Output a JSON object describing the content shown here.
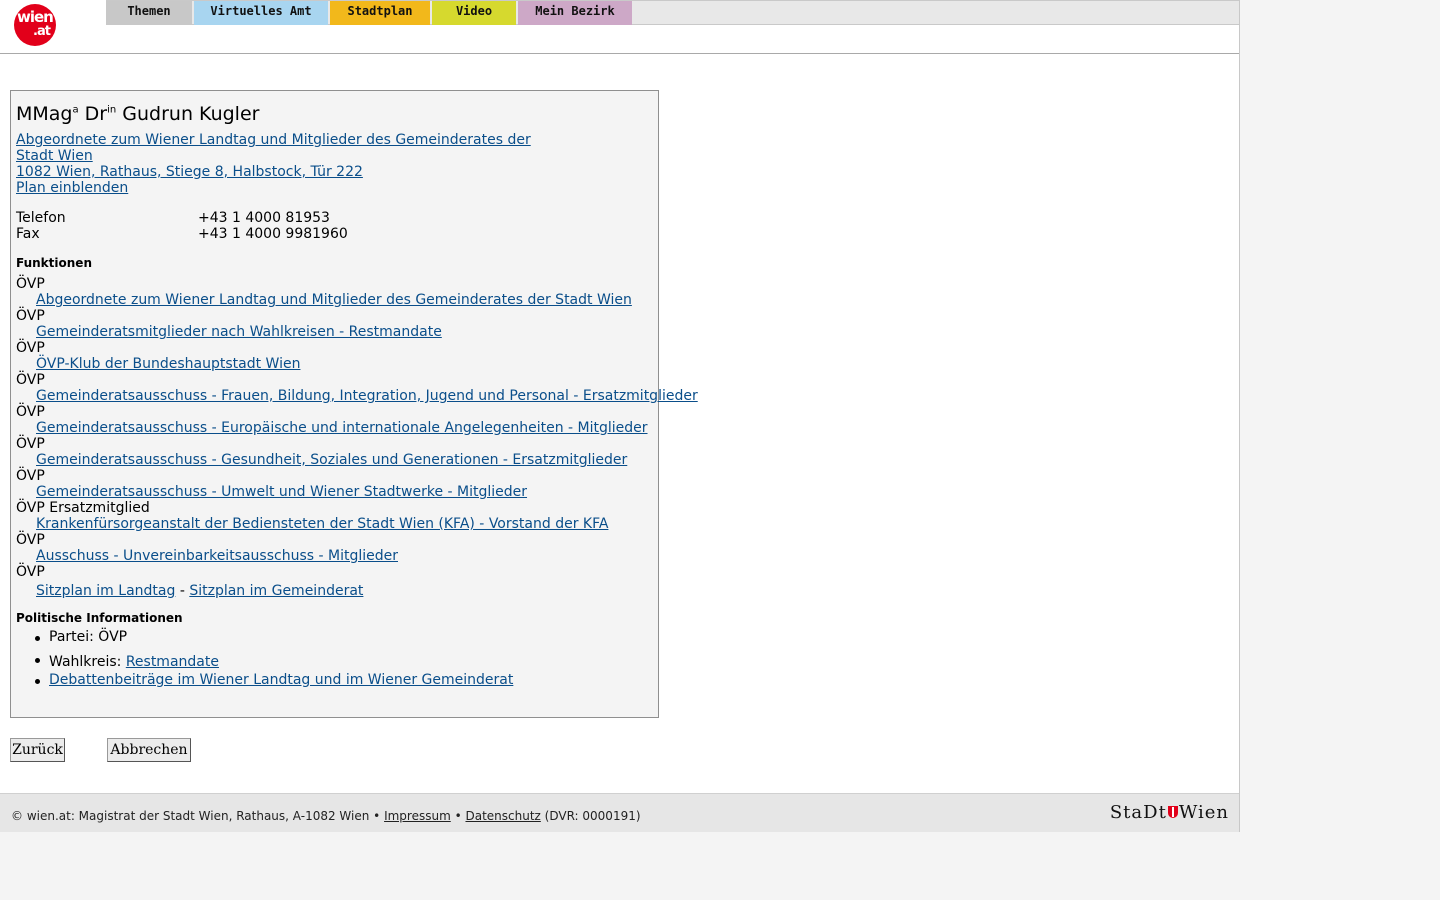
{
  "header": {
    "logo_text_main": "wien",
    "logo_text_sub": ".at",
    "tabs": [
      "Themen",
      "Virtuelles Amt",
      "Stadtplan",
      "Video",
      "Mein Bezirk"
    ],
    "tab_colors": [
      "#c8c8c8",
      "#a8d5f0",
      "#f2b81b",
      "#d6d92e",
      "#cda8c7"
    ]
  },
  "person": {
    "name_part1": "MMag",
    "name_sup1": "a",
    "name_part2": " Dr",
    "name_sup2": "in",
    "name_part3": " Gudrun Kugler",
    "role_line1": "Abgeordnete zum Wiener Landtag und Mitglieder des Gemeinderates der",
    "role_line2": "Stadt Wien ",
    "address": "1082 Wien, Rathaus, Stiege 8, Halbstock, Tür 222",
    "plan_link": "Plan einblenden"
  },
  "contact": {
    "phone_label": "Telefon",
    "phone_value": "+43 1 4000 81953",
    "fax_label": "Fax",
    "fax_value": "+43 1 4000 9981960"
  },
  "functions": {
    "heading": "Funktionen",
    "items": [
      {
        "party": "ÖVP",
        "link": "Abgeordnete zum Wiener Landtag und Mitglieder des Gemeinderates der Stadt Wien"
      },
      {
        "party": "ÖVP",
        "link": "Gemeinderatsmitglieder nach Wahlkreisen - Restmandate"
      },
      {
        "party": "ÖVP",
        "link": "ÖVP-Klub der Bundeshauptstadt Wien"
      },
      {
        "party": "ÖVP",
        "link": "Gemeinderatsausschuss - Frauen, Bildung, Integration, Jugend und Personal - Ersatzmitglieder"
      },
      {
        "party": "ÖVP",
        "link": "Gemeinderatsausschuss - Europäische und internationale Angelegenheiten - Mitglieder"
      },
      {
        "party": "ÖVP",
        "link": "Gemeinderatsausschuss - Gesundheit, Soziales und Generationen - Ersatzmitglieder"
      },
      {
        "party": "ÖVP",
        "link": "Gemeinderatsausschuss - Umwelt und Wiener Stadtwerke - Mitglieder"
      },
      {
        "party": "ÖVP Ersatzmitglied",
        "link": "Krankenfürsorgeanstalt der Bediensteten der Stadt Wien (KFA) - Vorstand der KFA"
      },
      {
        "party": "ÖVP",
        "link": "Ausschuss - Unvereinbarkeitsausschuss - Mitglieder"
      }
    ],
    "last_party": "ÖVP",
    "seat_link1": "Sitzplan im Landtag",
    "seat_sep": " - ",
    "seat_link2": "Sitzplan im Gemeinderat"
  },
  "political": {
    "heading": "Politische Informationen",
    "party_label": "Partei: ÖVP",
    "wahlkreis_label": "Wahlkreis: ",
    "wahlkreis_link": "Restmandate",
    "debate_link": "Debattenbeiträge im Wiener Landtag und im Wiener Gemeinderat"
  },
  "buttons": {
    "back": "Zurück",
    "cancel": "Abbrechen"
  },
  "footer": {
    "copyright": "© wien.at: Magistrat der Stadt Wien, Rathaus, A-1082 Wien • ",
    "impressum": "Impressum",
    "sep": " • ",
    "datenschutz": "Datenschutz",
    "dvr": " (DVR: 0000191)",
    "logo_left": "StaDt",
    "logo_right": "Wien"
  }
}
